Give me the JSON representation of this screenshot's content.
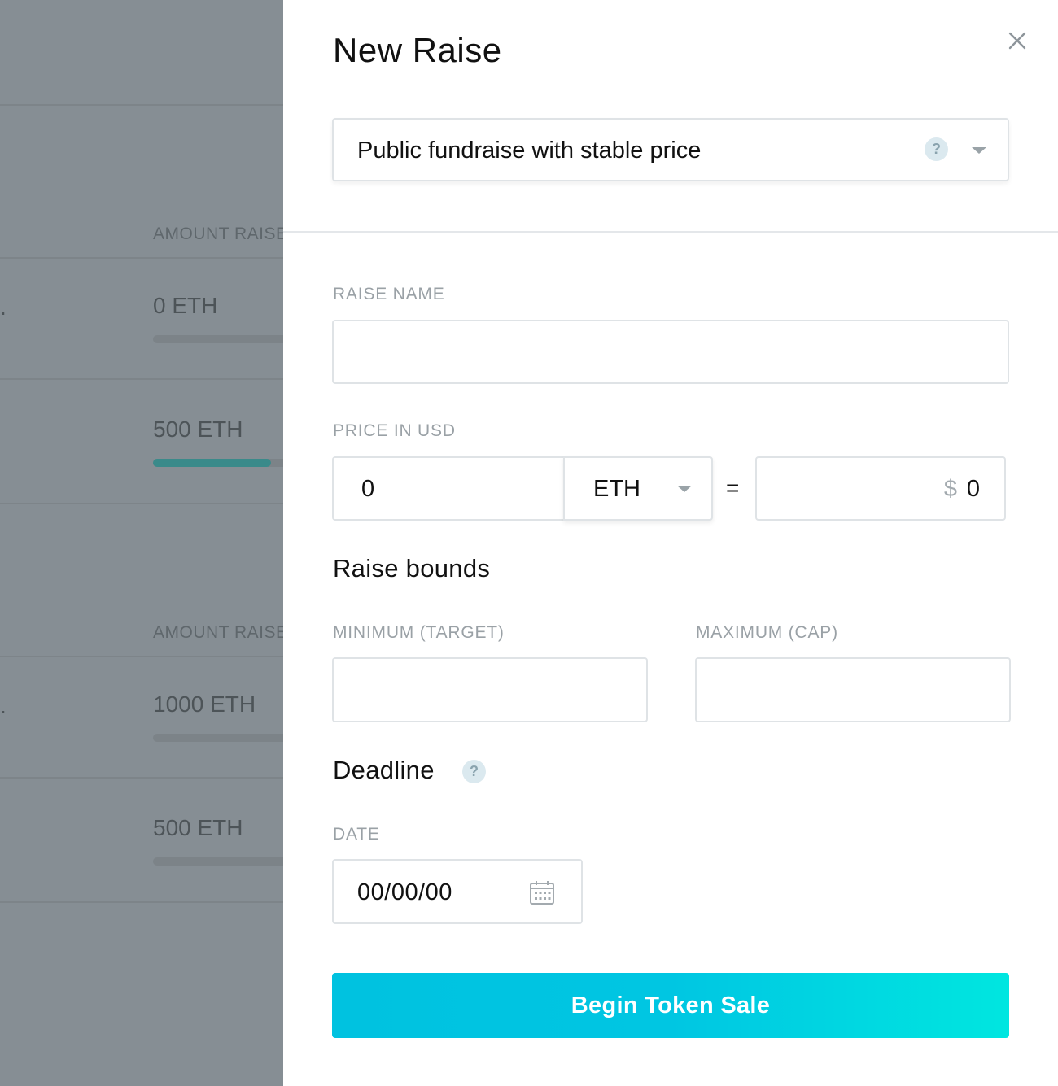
{
  "background": {
    "groups": [
      {
        "header": "AMOUNT RAISE",
        "rows": [
          {
            "prefix": ".",
            "amount": "0 ETH",
            "progress": 0
          },
          {
            "prefix": "",
            "amount": "500 ETH",
            "progress": 0.85
          }
        ]
      },
      {
        "header": "AMOUNT RAISE",
        "rows": [
          {
            "prefix": ".",
            "amount": "1000 ETH",
            "progress": 0
          },
          {
            "prefix": "",
            "amount": "500 ETH",
            "progress": 0
          }
        ]
      }
    ]
  },
  "panel": {
    "title": "New Raise",
    "raise_type": {
      "selected": "Public fundraise with stable price",
      "help": "?"
    },
    "raise_name": {
      "label": "RAISE NAME",
      "value": ""
    },
    "price": {
      "label": "PRICE IN USD",
      "amount": "0",
      "currency": "ETH",
      "equals": "=",
      "usd_symbol": "$",
      "usd_value": "0"
    },
    "bounds": {
      "title": "Raise bounds",
      "min_label": "MINIMUM (TARGET)",
      "min_value": "",
      "max_label": "MAXIMUM (CAP)",
      "max_value": ""
    },
    "deadline": {
      "title": "Deadline",
      "help": "?",
      "date_label": "DATE",
      "date_value": "00/00/00"
    },
    "submit_label": "Begin Token Sale"
  },
  "colors": {
    "accent_start": "#00c2e0",
    "accent_end": "#00e6e0",
    "progress_fill": "#3a8a8a"
  }
}
